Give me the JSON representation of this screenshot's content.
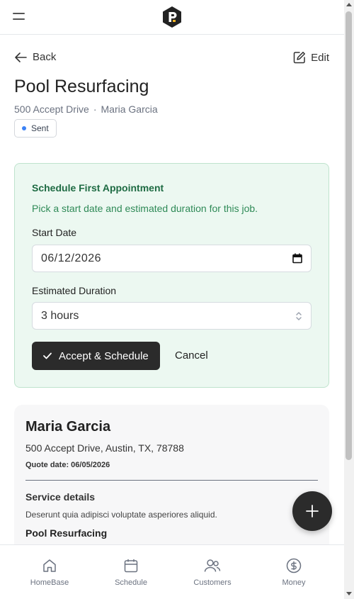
{
  "header": {
    "menu_icon": "hamburger-icon",
    "logo_icon": "app-logo-icon"
  },
  "nav": {
    "back_label": "Back",
    "edit_label": "Edit"
  },
  "job": {
    "title": "Pool Resurfacing",
    "address": "500 Accept Drive",
    "separator": "·",
    "customer": "Maria Garcia",
    "status": "Sent",
    "status_color": "#3b82f6"
  },
  "schedule": {
    "title": "Schedule First Appointment",
    "description": "Pick a start date and estimated duration for this job.",
    "start_date_label": "Start Date",
    "start_date_value": "06/12/2026",
    "duration_label": "Estimated Duration",
    "duration_value": "3 hours",
    "accept_button": "Accept & Schedule",
    "cancel_button": "Cancel",
    "bg_color": "#ecf8f1",
    "accent_color": "#1e6b43"
  },
  "quote": {
    "customer_name": "Maria Garcia",
    "address": "500 Accept Drive, Austin, TX, 78788",
    "quote_date": "Quote date: 06/05/2026",
    "service_heading": "Service details",
    "service_description": "Deserunt quia adipisci voluptate asperiores aliquid.",
    "service_item": "Pool Resurfacing"
  },
  "fab": {
    "icon": "plus-icon"
  },
  "bottom_nav": [
    {
      "label": "HomeBase",
      "icon": "home-icon"
    },
    {
      "label": "Schedule",
      "icon": "calendar-icon"
    },
    {
      "label": "Customers",
      "icon": "users-icon"
    },
    {
      "label": "Money",
      "icon": "dollar-icon"
    }
  ]
}
